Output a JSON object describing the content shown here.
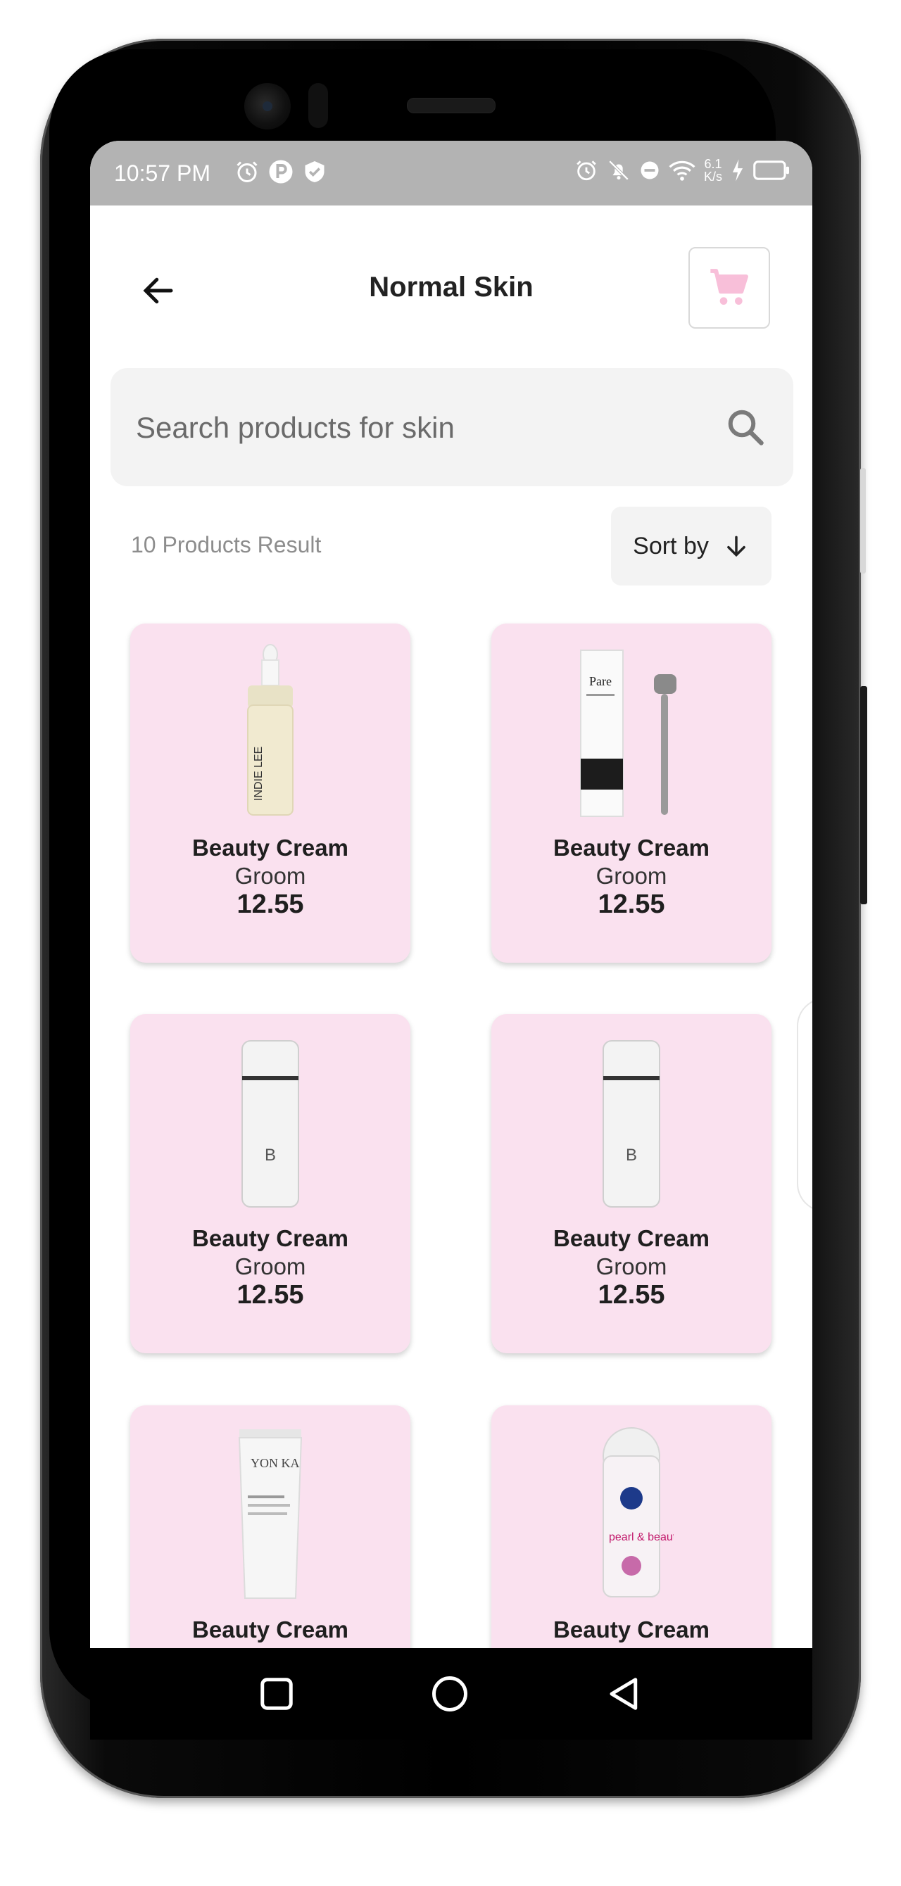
{
  "status_bar": {
    "time": "10:57 PM",
    "speed_value": "6.1",
    "speed_unit": "K/s",
    "left_icons": [
      "alarm-icon",
      "parking-icon",
      "shield-check-icon"
    ],
    "right_icons": [
      "alarm-icon",
      "bell-off-icon",
      "do-not-disturb-icon",
      "wifi-icon",
      "charging-icon",
      "battery-icon"
    ]
  },
  "header": {
    "title": "Normal Skin",
    "back_icon": "arrow-left-icon",
    "cart_icon": "cart-icon",
    "accent_color": "#f8bfd9"
  },
  "search": {
    "placeholder": "Search products for skin",
    "value": ""
  },
  "results": {
    "count_label": "10 Products Result",
    "sort_label": "Sort by"
  },
  "products": [
    {
      "name": "Beauty Cream",
      "brand": "Groom",
      "price": "12.55",
      "image": "dropper-serum-bottle",
      "image_text": "INDIE LEE"
    },
    {
      "name": "Beauty Cream",
      "brand": "Groom",
      "price": "12.55",
      "image": "box-and-derma-roller",
      "image_text": "Pare"
    },
    {
      "name": "Beauty Cream",
      "brand": "Groom",
      "price": "12.55",
      "image": "white-pump-bottle",
      "image_text": "B"
    },
    {
      "name": "Beauty Cream",
      "brand": "Groom",
      "price": "12.55",
      "image": "white-pump-bottle",
      "image_text": "B"
    },
    {
      "name": "Beauty Cream",
      "image": "cream-tube",
      "image_text": "YON KA"
    },
    {
      "name": "Beauty Cream",
      "image": "roll-on-deodorant",
      "image_text": "pearl & beauty"
    }
  ],
  "colors": {
    "card_background": "#fae1ef",
    "status_bar": "#b3b3b3",
    "search_background": "#f3f3f3"
  },
  "nav": {
    "icons": [
      "square-recent-icon",
      "circle-home-icon",
      "triangle-back-icon"
    ]
  }
}
